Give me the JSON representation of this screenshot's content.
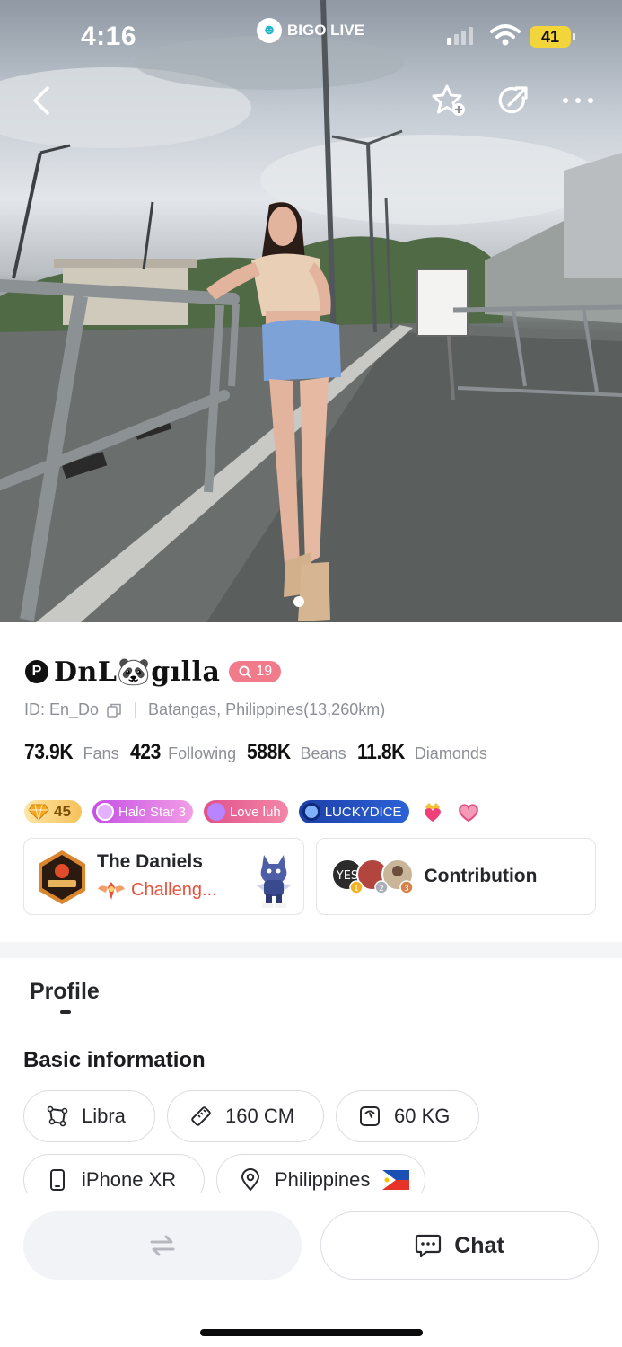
{
  "status_bar": {
    "time": "4:16",
    "brand": "BIGO LIVE",
    "battery": "41"
  },
  "top_nav": {
    "back_icon": "chevron-left-icon",
    "follow_icon": "star-plus-icon",
    "share_icon": "share-icon",
    "more_icon": "more-horizontal-icon"
  },
  "profile": {
    "name": "DnL🐼gılla",
    "prefix_badge": "P",
    "level": "19",
    "id_text": "ID: En_Do",
    "location": "Batangas, Philippines(13,260km)",
    "stats": [
      {
        "value": "73.9K",
        "label": "Fans"
      },
      {
        "value": "423",
        "label": "Following"
      },
      {
        "value": "588K",
        "label": "Beans"
      },
      {
        "value": "11.8K",
        "label": "Diamonds"
      }
    ],
    "badges": {
      "gem_level": "45",
      "halo": "Halo Star 3",
      "love": "Love luh",
      "lucky": "LUCKYDICE"
    }
  },
  "family_card": {
    "title": "The Daniels",
    "subtitle": "Challeng..."
  },
  "contribution_card": {
    "title": "Contribution",
    "ranks": [
      "1",
      "2",
      "3"
    ]
  },
  "tabs": {
    "profile": "Profile"
  },
  "basic_info": {
    "title": "Basic information",
    "zodiac": "Libra",
    "height": "160 CM",
    "weight": "60 KG",
    "device": "iPhone XR",
    "country": "Philippines",
    "country_flag": "🇵🇭"
  },
  "bottom_bar": {
    "chat_label": "Chat"
  },
  "colors": {
    "level_chip": "#f17b8a",
    "challenge_text": "#e8513c",
    "lucky_badge": "#1d3fa8"
  }
}
